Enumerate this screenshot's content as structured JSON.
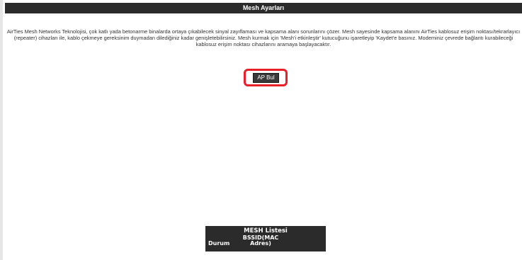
{
  "header": {
    "title": "Mesh Ayarları"
  },
  "description": {
    "text": "AirTies Mesh Networks Teknolojisi, çok katlı yada betonarme binalarda ortaya çıkabilecek sinyal zayıflaması ve kapsama alanı sorunlarını çözer. Mesh sayesinde kapsama alanını AirTies kablosuz erişim noktası/tekrarlayıcı (repeater) cihazları ile, kablo çekmeye gereksinim duymadan dilediğiniz kadar genişletebilirsiniz. Mesh kurmak için 'Mesh'i etkinleştir' kutucuğunu işaretleyip 'Kaydet'e basınız. Modeminiz çevrede bağlantı kurabileceği kablosuz erişim noktası cihazlarını aramaya başlayacaktır."
  },
  "actions": {
    "ap_bul_label": "AP Bul"
  },
  "mesh_table": {
    "title": "MESH Listesi",
    "columns": [
      "Durum",
      "BSSID(MAC Adres)"
    ]
  },
  "colors": {
    "header_bg": "#2b2b2b",
    "highlight": "#e8202a",
    "button_bg": "#3a3a3a"
  }
}
